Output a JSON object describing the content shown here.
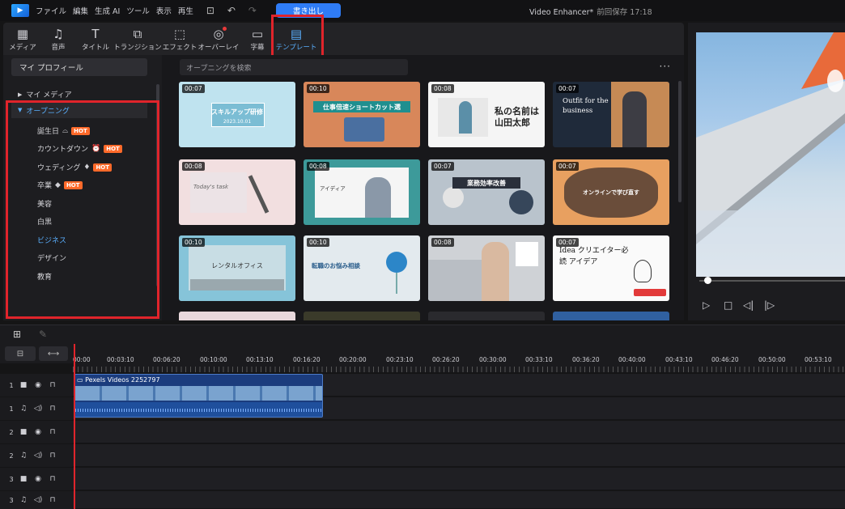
{
  "menu": {
    "logo": "▶",
    "items": [
      "ファイル",
      "編集",
      "生成 AI",
      "ツール",
      "表示",
      "再生"
    ],
    "export_label": "書き出し"
  },
  "project": {
    "title": "Video Enhancer*",
    "save_status": "前回保存 17:18"
  },
  "tabs": [
    {
      "label": "メディア",
      "icon": "media-icon",
      "glyph": "▦"
    },
    {
      "label": "音声",
      "icon": "music-icon",
      "glyph": "♫"
    },
    {
      "label": "タイトル",
      "icon": "title-icon",
      "glyph": "T"
    },
    {
      "label": "トランジション",
      "icon": "transition-icon",
      "glyph": "⧉"
    },
    {
      "label": "エフェクト",
      "icon": "effect-icon",
      "glyph": "⬚"
    },
    {
      "label": "オーバーレイ",
      "icon": "overlay-icon",
      "glyph": "◎"
    },
    {
      "label": "字幕",
      "icon": "subtitle-icon",
      "glyph": "▭"
    },
    {
      "label": "テンプレート",
      "icon": "template-icon",
      "glyph": "▤"
    }
  ],
  "sidebar": {
    "profile": "マイ プロフィール",
    "my_media": "マイ メディア",
    "opening": "オープニング",
    "categories": [
      {
        "label": "誕生日",
        "hot": true,
        "icon": "cake-icon",
        "glyph": "⌓"
      },
      {
        "label": "カウントダウン",
        "hot": true,
        "icon": "clock-icon",
        "glyph": "⏰"
      },
      {
        "label": "ウェディング",
        "hot": true,
        "icon": "bell-icon",
        "glyph": "♦"
      },
      {
        "label": "卒業",
        "hot": true,
        "icon": "grad-cap-icon",
        "glyph": "◆"
      },
      {
        "label": "美容",
        "hot": false
      },
      {
        "label": "白黒",
        "hot": false
      },
      {
        "label": "ビジネス",
        "hot": false,
        "active": true
      },
      {
        "label": "デザイン",
        "hot": false
      },
      {
        "label": "教育",
        "hot": false
      }
    ],
    "hot_label": "HOT"
  },
  "search": {
    "placeholder": "オープニングを検索"
  },
  "templates": [
    {
      "duration": "00:07",
      "text": "スキルアップ研修",
      "sub": "2023.10.01"
    },
    {
      "duration": "00:10",
      "text": "仕事倍速ショートカット選"
    },
    {
      "duration": "00:08",
      "text": "私の名前は 山田太郎"
    },
    {
      "duration": "00:07",
      "text": "Outfit for the business"
    },
    {
      "duration": "00:08",
      "text": "Today's task"
    },
    {
      "duration": "00:08",
      "text": "アイディア"
    },
    {
      "duration": "00:07",
      "text": "業務効率改善"
    },
    {
      "duration": "00:07",
      "text": "オンラインで学び直す"
    },
    {
      "duration": "00:10",
      "text": "レンタルオフィス"
    },
    {
      "duration": "00:10",
      "text": "転職のお悩み相談"
    },
    {
      "duration": "00:08",
      "text": ""
    },
    {
      "duration": "00:07",
      "text": "Idea クリエイター必読 アイデア"
    }
  ],
  "timeline": {
    "ticks": [
      "00:00",
      "00:03:10",
      "00:06:20",
      "00:10:00",
      "00:13:10",
      "00:16:20",
      "00:20:00",
      "00:23:10",
      "00:26:20",
      "00:30:00",
      "00:33:10",
      "00:36:20",
      "00:40:00",
      "00:43:10",
      "00:46:20",
      "00:50:00",
      "00:53:10"
    ],
    "clip_name": "Pexels Videos 2252797",
    "tracks": [
      {
        "num": "1",
        "type": "video"
      },
      {
        "num": "1",
        "type": "audio"
      },
      {
        "num": "2",
        "type": "video"
      },
      {
        "num": "2",
        "type": "audio"
      },
      {
        "num": "3",
        "type": "video"
      },
      {
        "num": "3",
        "type": "audio"
      }
    ]
  },
  "colors": {
    "accent": "#2f7cf6",
    "highlight": "#e0242b",
    "hot": "#ff6a2a"
  }
}
